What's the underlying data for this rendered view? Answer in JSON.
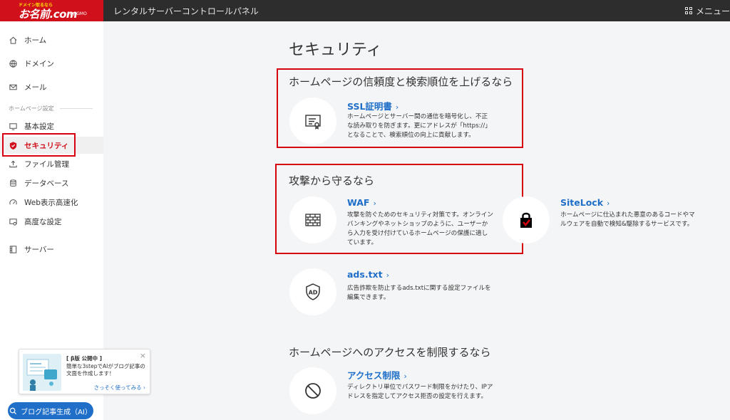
{
  "header": {
    "logo_tag": "ドメイン取るなら",
    "logo_name": "お名前.com",
    "logo_sub": "by GMO",
    "title": "レンタルサーバーコントロールパネル",
    "menu_label": "メニュー"
  },
  "sidebar": {
    "items": [
      {
        "label": "ホーム",
        "icon": "home-icon"
      },
      {
        "label": "ドメイン",
        "icon": "globe-icon"
      },
      {
        "label": "メール",
        "icon": "mail-icon"
      }
    ],
    "section_label": "ホームページ設定",
    "sub_items": [
      {
        "label": "基本設定",
        "icon": "monitor-icon"
      },
      {
        "label": "セキュリティ",
        "icon": "shield-icon"
      },
      {
        "label": "ファイル管理",
        "icon": "upload-icon"
      },
      {
        "label": "データベース",
        "icon": "database-icon"
      },
      {
        "label": "Web表示高速化",
        "icon": "speed-icon"
      },
      {
        "label": "高度な設定",
        "icon": "advanced-settings-icon"
      },
      {
        "label": "サーバー",
        "icon": "server-icon"
      }
    ]
  },
  "promo": {
    "title": "[ β版 公開中 ]",
    "desc": "簡単な3stepでAIがブログ記事の文面を作成します！",
    "link": "さっそく使ってみる",
    "close": "×",
    "ai_button": "ブログ記事生成（AI）"
  },
  "main": {
    "page_title": "セキュリティ",
    "sections": [
      {
        "title": "ホームページの信頼度と検索順位を上げるなら"
      },
      {
        "title": "攻撃から守るなら"
      },
      {
        "title": "ホームページへのアクセスを制限するなら"
      }
    ],
    "services": {
      "ssl": {
        "name": "SSL証明書",
        "desc": "ホームページとサーバー間の通信を暗号化し、不正な読み取りを防ぎます。更にアドレスが「https://」となることで、検索順位の向上に貢献します。"
      },
      "waf": {
        "name": "WAF",
        "desc": "攻撃を防ぐためのセキュリティ対策です。オンラインバンキングやネットショップのように、ユーザーから入力を受け付けているホームページの保護に適しています。"
      },
      "sitelock": {
        "name": "SiteLock",
        "desc": "ホームページに仕込まれた悪意のあるコードやマルウェアを自動で検知&駆除するサービスです。"
      },
      "ads": {
        "name": "ads.txt",
        "desc": "広告詐欺を防止するads.txtに関する設定ファイルを編集できます。",
        "icon_text": "AD"
      },
      "access": {
        "name": "アクセス制限",
        "desc": "ディレクトリ単位でパスワード制限をかけたり、IPアドレスを指定してアクセス拒否の設定を行えます。"
      }
    },
    "chevron": "›"
  },
  "colors": {
    "accent": "#d0101b",
    "link": "#1f6fc9",
    "highlight_box": "#d7000f"
  }
}
